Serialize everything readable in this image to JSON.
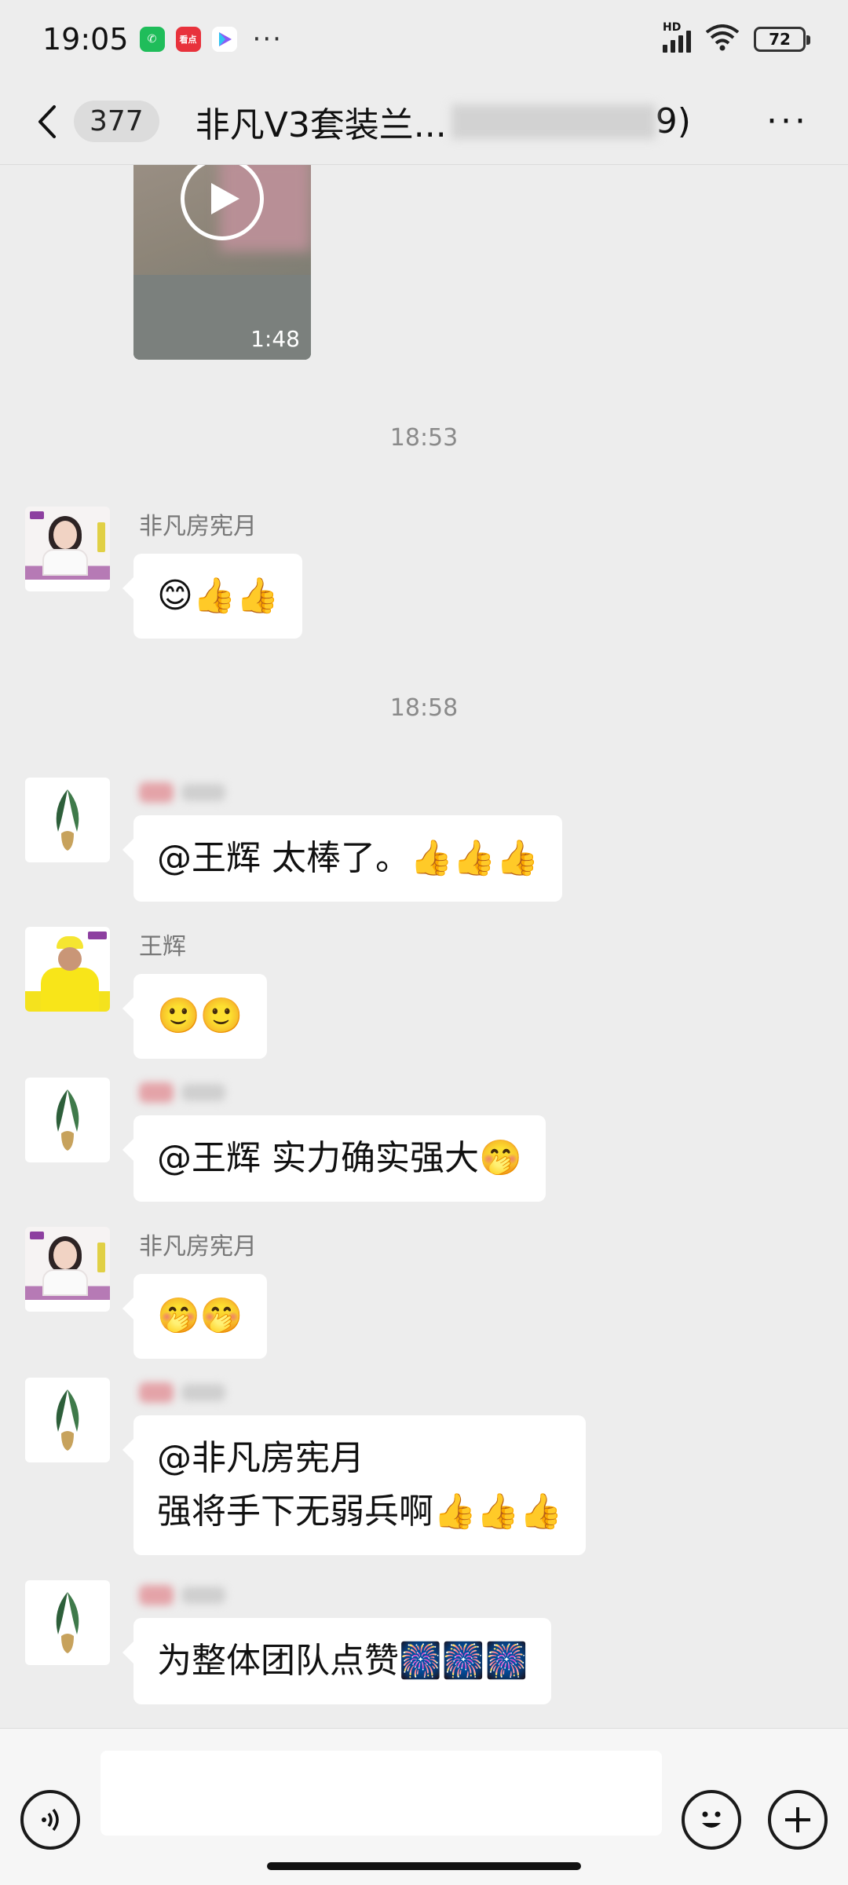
{
  "status_bar": {
    "time": "19:05",
    "apps": [
      {
        "name": "phone-app-icon",
        "color": "#1fbd5a",
        "glyph": "✆"
      },
      {
        "name": "news-app-icon",
        "color": "#e8323c",
        "glyph": "看点"
      },
      {
        "name": "video-app-icon",
        "color": "#ffffff",
        "glyph": "▶"
      }
    ],
    "more": "···",
    "network": "HD",
    "battery": "72"
  },
  "header": {
    "unread_count": "377",
    "title": "非凡V3套装兰...",
    "title_end": "9)",
    "more": "···"
  },
  "video": {
    "duration": "1:48"
  },
  "timestamps": [
    "18:53",
    "18:58"
  ],
  "messages": [
    {
      "sender": "非凡房宪月",
      "lines": [
        "😊👍👍"
      ]
    },
    {
      "sender": "",
      "lines": [
        "@王辉  太棒了。👍👍👍"
      ]
    },
    {
      "sender": "王辉",
      "lines": [
        "🙂🙂"
      ]
    },
    {
      "sender": "",
      "lines": [
        "@王辉  实力确实强大🤭"
      ]
    },
    {
      "sender": "非凡房宪月",
      "lines": [
        "🤭🤭"
      ]
    },
    {
      "sender": "",
      "lines": [
        "@非凡房宪月",
        "强将手下无弱兵啊👍👍👍"
      ]
    },
    {
      "sender": "",
      "lines": [
        "为整体团队点赞🎆🎆🎆"
      ]
    }
  ],
  "input": {
    "placeholder": ""
  },
  "colors": {
    "background": "#ededed",
    "bubble": "#ffffff",
    "timestamp": "#8a8a8a"
  }
}
